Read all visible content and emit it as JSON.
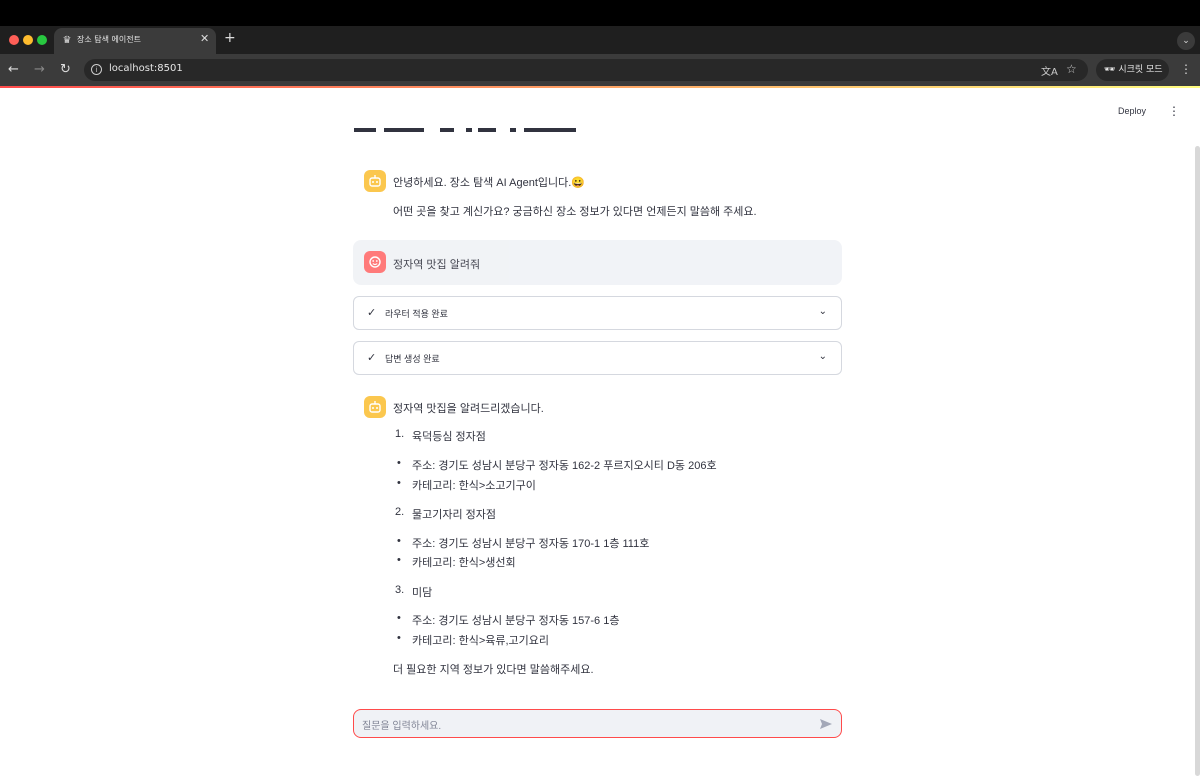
{
  "browser": {
    "tab_title": "장소 탐색 에이전트",
    "url": "localhost:8501",
    "incognito_label": "시크릿 모드"
  },
  "app": {
    "deploy_label": "Deploy"
  },
  "chat": {
    "greeting_line1": "안녕하세요. 장소 탐색 AI Agent입니다.😀",
    "greeting_line2": "어떤 곳을 찾고 계신가요? 궁금하신 장소 정보가 있다면 언제든지 말씀해 주세요.",
    "user_message": "정자역 맛집 알려줘",
    "status_router": "라우터 적용 완료",
    "status_answer": "답변 생성 완료",
    "answer_intro": "정자역 맛집을 알려드리겠습니다.",
    "places": [
      {
        "number": "1.",
        "name": "육덕등심 정자점",
        "address": "주소: 경기도 성남시 분당구 정자동 162-2 푸르지오시티 D동 206호",
        "category": "카테고리: 한식>소고기구이"
      },
      {
        "number": "2.",
        "name": "물고기자리 정자점",
        "address": "주소: 경기도 성남시 분당구 정자동 170-1 1층 111호",
        "category": "카테고리: 한식>생선회"
      },
      {
        "number": "3.",
        "name": "미담",
        "address": "주소: 경기도 성남시 분당구 정자동 157-6 1층",
        "category": "카테고리: 한식>육류,고기요리"
      }
    ],
    "closing": "더 필요한 지역 정보가 있다면 말씀해주세요.",
    "input_placeholder": "질문을 입력하세요."
  },
  "colors": {
    "bot_avatar": "#fbc74e",
    "user_avatar": "#ff6c6c",
    "accent": "#ff4b4b"
  },
  "icons": {
    "bot_avatar": "robot-icon",
    "user_avatar": "user-face-icon",
    "status": "check-icon",
    "expand": "chevron-down-icon",
    "send": "send-icon"
  }
}
